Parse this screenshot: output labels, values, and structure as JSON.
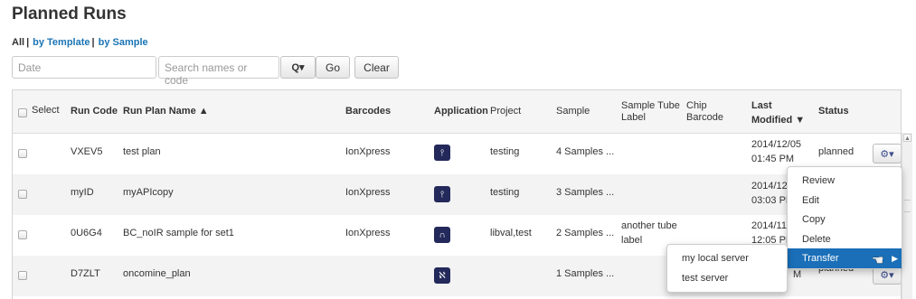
{
  "page": {
    "title": "Planned Runs"
  },
  "filters": {
    "all": "All",
    "sep": "|",
    "by_template": "by Template",
    "by_sample": "by Sample"
  },
  "search": {
    "date_placeholder": "Date",
    "names_placeholder": "Search names or code",
    "search_icon": "Q▾",
    "go": "Go",
    "clear": "Clear"
  },
  "table": {
    "headers": {
      "select": "Select",
      "run_code": "Run Code",
      "run_plan_name": "Run Plan Name ▲",
      "barcodes": "Barcodes",
      "application": "Application",
      "project": "Project",
      "sample": "Sample",
      "sample_tube_1": "Sample Tube",
      "sample_tube_2": "Label",
      "chip_1": "Chip",
      "chip_2": "Barcode",
      "last_1": "Last",
      "last_2": "Modified ▼",
      "status": "Status"
    },
    "rows": [
      {
        "run_code": "VXEV5",
        "name": "test plan",
        "barcodes": "IonXpress",
        "app_icon": "dna-tube-icon",
        "project": "testing",
        "sample": "4 Samples ...",
        "tube_1": "",
        "tube_2": "",
        "date": "2014/12/05",
        "time": "01:45 PM",
        "status": "planned"
      },
      {
        "run_code": "myID",
        "name": "myAPIcopy",
        "barcodes": "IonXpress",
        "app_icon": "dna-tube-icon",
        "project": "testing",
        "sample": "3 Samples ...",
        "tube_1": "",
        "tube_2": "",
        "date": "2014/12/",
        "time": "03:03 PM",
        "status": ""
      },
      {
        "run_code": "0U6G4",
        "name": "BC_noIR sample for set1",
        "barcodes": "IonXpress",
        "app_icon": "magnet-icon",
        "project": "libval,test",
        "sample": "2 Samples ...",
        "tube_1": "another tube",
        "tube_2": "label",
        "date": "2014/11/",
        "time": "12:05 PM",
        "status": ""
      },
      {
        "run_code": "D7ZLT",
        "name": "oncomine_plan",
        "barcodes": "",
        "app_icon": "dna-helix-icon",
        "project": "",
        "sample": "1 Samples ...",
        "tube_1": "",
        "tube_2": "",
        "date": "",
        "time": "M",
        "status": "planned"
      }
    ]
  },
  "context_menu": {
    "items": [
      "Review",
      "Edit",
      "Copy",
      "Delete",
      "Transfer"
    ]
  },
  "submenu": {
    "items": [
      "my local server",
      "test server"
    ]
  },
  "colors": {
    "link": "#1a74b5",
    "menu_active": "#1a6fb8",
    "app_icon_bg": "#23295a"
  }
}
